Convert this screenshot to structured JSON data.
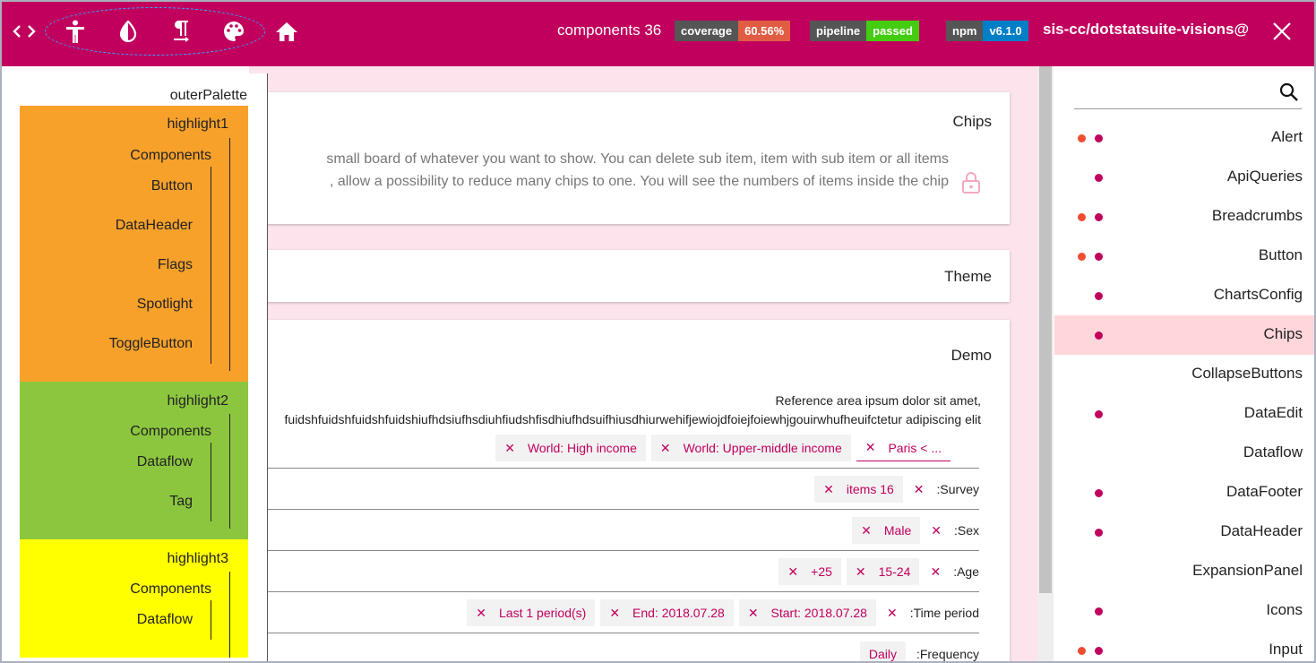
{
  "header": {
    "components_label": "components 36",
    "coverage": {
      "key": "coverage",
      "value": "60.56%",
      "color": "#e05d44"
    },
    "pipeline": {
      "key": "pipeline",
      "value": "passed",
      "color": "#4c1"
    },
    "npm": {
      "key": "npm",
      "value": "v6.1.0",
      "color": "#007ec6"
    },
    "repo": "sis-cc/dotstatsuite-visions@",
    "icons": [
      "code-icon",
      "accessibility-icon",
      "text-direction-icon",
      "palette-icon",
      "home-icon",
      "close-icon"
    ],
    "background": "#c1005d"
  },
  "palette": {
    "title": "outerPalette",
    "highlights": [
      {
        "name": "highlight1",
        "color": "#f7a12b",
        "items": [
          "Components",
          "Button",
          "DataHeader",
          "Flags",
          "Spotlight",
          "ToggleButton"
        ]
      },
      {
        "name": "highlight2",
        "color": "#8cc63f",
        "items": [
          "Components",
          "Dataflow",
          "Tag"
        ]
      },
      {
        "name": "highlight3",
        "color": "#ffff00",
        "items": [
          "Components",
          "Dataflow"
        ]
      }
    ]
  },
  "main": {
    "chips_card": {
      "title": "Chips",
      "desc_line1": "small board of whatever you want to show. You can delete sub item, item with sub item or all items",
      "desc_line2": ", allow a possibility to reduce many chips to one. You will see the numbers of items inside the chip"
    },
    "theme_card": {
      "title": "Theme"
    },
    "demo_card": {
      "title": "Demo",
      "ref_line1": "Reference area ipsum dolor sit amet,",
      "ref_line2": "fuidshfuidshfuidshfuidshiufhdsiufhsdiuhfiudshfisdhiufhdsuifhiusdhiurwehifjewiojdfoiejfoiewhjgouirwhufheuifctetur adipiscing elit",
      "row1_chips": [
        "World: High income",
        "World: Upper-middle income",
        "Paris < ..."
      ],
      "survey": {
        "chip": "items 16",
        "label": ":Survey"
      },
      "sex": {
        "chip": "Male",
        "label": ":Sex"
      },
      "age": {
        "chips": [
          "+25",
          "15-24"
        ],
        "label": ":Age"
      },
      "time": {
        "chips": [
          "Last 1 period(s)",
          "End: 2018.07.28",
          "Start: 2018.07.28"
        ],
        "label": ":Time period"
      },
      "frequency": {
        "chip": "Daily",
        "label": ":Frequency"
      }
    }
  },
  "nav": {
    "items": [
      {
        "label": "Alert",
        "dots": 2
      },
      {
        "label": "ApiQueries",
        "dots": 1
      },
      {
        "label": "Breadcrumbs",
        "dots": 2
      },
      {
        "label": "Button",
        "dots": 2
      },
      {
        "label": "ChartsConfig",
        "dots": 1
      },
      {
        "label": "Chips",
        "dots": 1,
        "active": true
      },
      {
        "label": "CollapseButtons",
        "dots": 0
      },
      {
        "label": "DataEdit",
        "dots": 1
      },
      {
        "label": "Dataflow",
        "dots": 0
      },
      {
        "label": "DataFooter",
        "dots": 1
      },
      {
        "label": "DataHeader",
        "dots": 1
      },
      {
        "label": "ExpansionPanel",
        "dots": 0
      },
      {
        "label": "Icons",
        "dots": 1
      },
      {
        "label": "Input",
        "dots": 2
      }
    ]
  }
}
